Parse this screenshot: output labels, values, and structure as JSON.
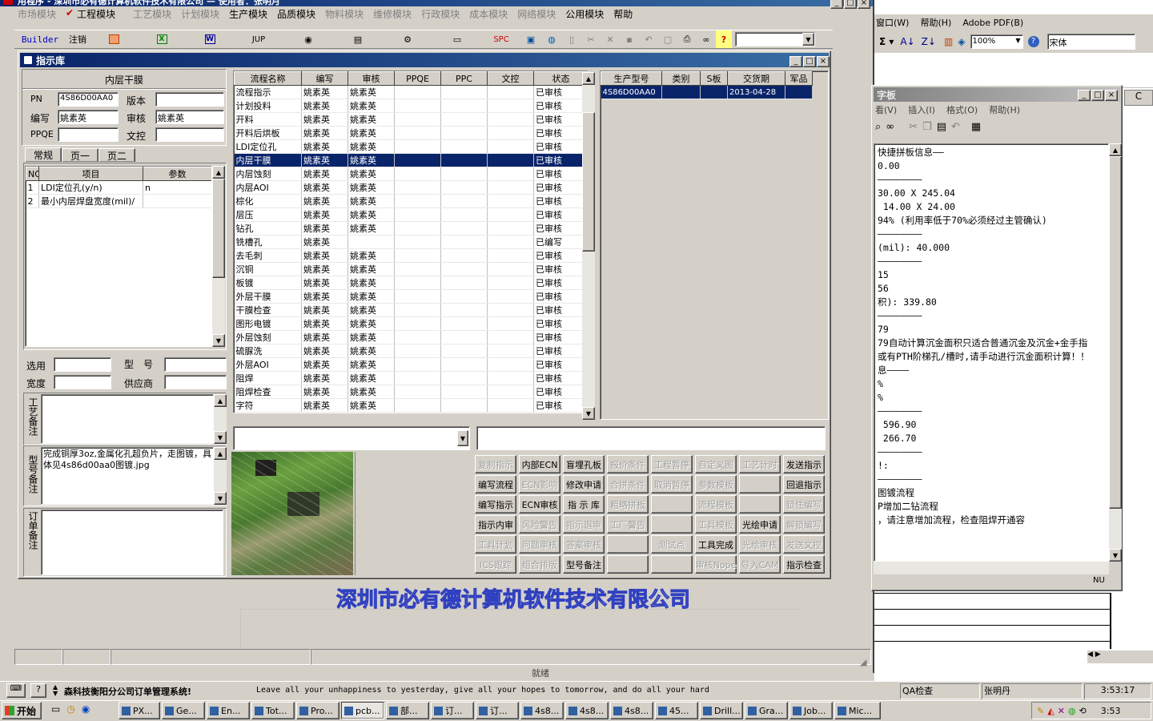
{
  "app": {
    "title": "用程序 - 深圳市必有德计算机软件技术有限公司 — 使用者：张明月",
    "menu": [
      "市场模块",
      "工程模块",
      "工艺模块",
      "计划模块",
      "生产模块",
      "品质模块",
      "物料模块",
      "维修模块",
      "行政模块",
      "成本模块",
      "网络模块",
      "公用模块",
      "帮助"
    ],
    "toolbar": {
      "builder": "Builder",
      "logout": "注销",
      "jup": "JUP",
      "spc": "SPC"
    },
    "company_watermark": "深圳市必有德计算机软件技术有限公司",
    "status_text": "就绪"
  },
  "dialog": {
    "title": "指示库",
    "left": {
      "header": "内层干膜",
      "pn_label": "PN",
      "pn_value": "4S86D00AA0",
      "version_label": "版本",
      "version_value": "",
      "writer_label": "编写",
      "writer_value": "姚素英",
      "reviewer_label": "审核",
      "reviewer_value": "姚素英",
      "ppqe_label": "PPQE",
      "ppqe_value": "",
      "doc_label": "文控",
      "doc_value": "",
      "tabs": [
        "常规",
        "页一",
        "页二"
      ],
      "param_cols": [
        "NO",
        "项目",
        "参数"
      ],
      "params": [
        {
          "no": "1",
          "item": "LDI定位孔(y/n)",
          "value": "n"
        },
        {
          "no": "2",
          "item": "最小内层焊盘宽度(mil)/",
          "value": ""
        }
      ],
      "select_label": "选用",
      "model_label": "型　号",
      "width_label": "宽度",
      "supplier_label": "供应商",
      "remark1_label": "工艺备注",
      "remark2_label": "型号备注",
      "remark2_text": "完成铜厚3oz,金属化孔超负片，走图镀，具体见4s86d00aa0图镀.jpg",
      "remark3_label": "订单备注"
    },
    "flow_cols": [
      "流程名称",
      "编写",
      "审核",
      "PPQE",
      "PPC",
      "文控",
      "状态"
    ],
    "flows": [
      {
        "name": "流程指示",
        "writer": "姚素英",
        "reviewer": "姚素英",
        "status": "已审核"
      },
      {
        "name": "计划投料",
        "writer": "姚素英",
        "reviewer": "姚素英",
        "status": "已审核"
      },
      {
        "name": "开料",
        "writer": "姚素英",
        "reviewer": "姚素英",
        "status": "已审核"
      },
      {
        "name": "开料后烘板",
        "writer": "姚素英",
        "reviewer": "姚素英",
        "status": "已审核"
      },
      {
        "name": "LDI定位孔",
        "writer": "姚素英",
        "reviewer": "姚素英",
        "status": "已审核"
      },
      {
        "name": "内层干膜",
        "writer": "姚素英",
        "reviewer": "姚素英",
        "status": "已审核"
      },
      {
        "name": "内层蚀刻",
        "writer": "姚素英",
        "reviewer": "姚素英",
        "status": "已审核"
      },
      {
        "name": "内层AOI",
        "writer": "姚素英",
        "reviewer": "姚素英",
        "status": "已审核"
      },
      {
        "name": "棕化",
        "writer": "姚素英",
        "reviewer": "姚素英",
        "status": "已审核"
      },
      {
        "name": "层压",
        "writer": "姚素英",
        "reviewer": "姚素英",
        "status": "已审核"
      },
      {
        "name": "钻孔",
        "writer": "姚素英",
        "reviewer": "姚素英",
        "status": "已审核"
      },
      {
        "name": "铣槽孔",
        "writer": "姚素英",
        "reviewer": "",
        "status": "已编写"
      },
      {
        "name": "去毛刺",
        "writer": "姚素英",
        "reviewer": "姚素英",
        "status": "已审核"
      },
      {
        "name": "沉铜",
        "writer": "姚素英",
        "reviewer": "姚素英",
        "status": "已审核"
      },
      {
        "name": "板镀",
        "writer": "姚素英",
        "reviewer": "姚素英",
        "status": "已审核"
      },
      {
        "name": "外层干膜",
        "writer": "姚素英",
        "reviewer": "姚素英",
        "status": "已审核"
      },
      {
        "name": "干膜检查",
        "writer": "姚素英",
        "reviewer": "姚素英",
        "status": "已审核"
      },
      {
        "name": "图形电镀",
        "writer": "姚素英",
        "reviewer": "姚素英",
        "status": "已审核"
      },
      {
        "name": "外层蚀刻",
        "writer": "姚素英",
        "reviewer": "姚素英",
        "status": "已审核"
      },
      {
        "name": "硫脲洗",
        "writer": "姚素英",
        "reviewer": "姚素英",
        "status": "已审核"
      },
      {
        "name": "外层AOI",
        "writer": "姚素英",
        "reviewer": "姚素英",
        "status": "已审核"
      },
      {
        "name": "阻焊",
        "writer": "姚素英",
        "reviewer": "姚素英",
        "status": "已审核"
      },
      {
        "name": "阻焊检查",
        "writer": "姚素英",
        "reviewer": "姚素英",
        "status": "已审核"
      },
      {
        "name": "字符",
        "writer": "姚素英",
        "reviewer": "姚素英",
        "status": "已审核"
      }
    ],
    "selected_flow_index": 5,
    "model_cols": [
      "生产型号",
      "类别",
      "S板",
      "交货期",
      "军品"
    ],
    "models": [
      {
        "model": "4S86D00AA0",
        "category": "",
        "s": "",
        "due": "2013-04-28",
        "mil": ""
      }
    ],
    "actions": [
      [
        {
          "t": "复制指示",
          "e": false
        },
        {
          "t": "内部ECN",
          "e": true
        },
        {
          "t": "盲埋孔板",
          "e": true
        },
        {
          "t": "报价条件",
          "e": false
        },
        {
          "t": "工程暂停",
          "e": false
        },
        {
          "t": "自定义图",
          "e": false
        },
        {
          "t": "工艺计时",
          "e": false
        },
        {
          "t": "发送指示",
          "e": true
        }
      ],
      [
        {
          "t": "编写流程",
          "e": true
        },
        {
          "t": "ECN影响",
          "e": false
        },
        {
          "t": "修改申请",
          "e": true
        },
        {
          "t": "合拼条件",
          "e": false
        },
        {
          "t": "取消暂停",
          "e": false
        },
        {
          "t": "参数模板",
          "e": false
        },
        {
          "t": "",
          "e": false
        },
        {
          "t": "回退指示",
          "e": true
        }
      ],
      [
        {
          "t": "编写指示",
          "e": true
        },
        {
          "t": "ECN审核",
          "e": true
        },
        {
          "t": "指 示 库",
          "e": true
        },
        {
          "t": "粗略拼板",
          "e": false
        },
        {
          "t": "",
          "e": false
        },
        {
          "t": "流程模板",
          "e": false
        },
        {
          "t": "",
          "e": false
        },
        {
          "t": "锁住编写",
          "e": false
        }
      ],
      [
        {
          "t": "指示内审",
          "e": true
        },
        {
          "t": "风险警告",
          "e": false
        },
        {
          "t": "指示退审",
          "e": false
        },
        {
          "t": "工厂警告",
          "e": false
        },
        {
          "t": "",
          "e": false
        },
        {
          "t": "工具模板",
          "e": false
        },
        {
          "t": "光绘申请",
          "e": true
        },
        {
          "t": "解锁编写",
          "e": false
        }
      ],
      [
        {
          "t": "工具计划",
          "e": false
        },
        {
          "t": "问题审核",
          "e": false
        },
        {
          "t": "答案审核",
          "e": false
        },
        {
          "t": "",
          "e": false
        },
        {
          "t": "测试点",
          "e": false
        },
        {
          "t": "工具完成",
          "e": true
        },
        {
          "t": "光绘审核",
          "e": false
        },
        {
          "t": "发送文控",
          "e": false
        }
      ],
      [
        {
          "t": "ICS跟踪",
          "e": false
        },
        {
          "t": "组合排版",
          "e": false
        },
        {
          "t": "型号备注",
          "e": true
        },
        {
          "t": "",
          "e": false
        },
        {
          "t": "",
          "e": false
        },
        {
          "t": "审核Nope",
          "e": false
        },
        {
          "t": "导入CAM",
          "e": false
        },
        {
          "t": "指示检查",
          "e": true
        }
      ]
    ]
  },
  "excel": {
    "menu": [
      "窗口(W)",
      "帮助(H)",
      "Adobe PDF(B)"
    ],
    "zoom": "100%",
    "font": "宋体",
    "col_header": "C"
  },
  "notepad": {
    "title": "字板",
    "menu": [
      "看(V)",
      "插入(I)",
      "格式(O)",
      "帮助(H)"
    ],
    "lines": [
      "快捷拼板信息——",
      "0.00",
      "",
      "————————",
      "30.00 X 245.04",
      " 14.00 X 24.00",
      "94% (利用率低于70%必须经过主管确认)",
      "————————",
      "(mil): 40.000",
      "————————",
      "",
      "15",
      "56",
      "积): 339.80",
      "",
      "————————",
      "79",
      "79自动计算沉金面积只适合普通沉金及沉金+金手指",
      "或有PTH阶梯孔/槽时,请手动进行沉金面积计算！！",
      "息————",
      "%",
      "%",
      "————————",
      " 596.90",
      " 266.70",
      "————————",
      "!:",
      "",
      "————————",
      "图镀流程",
      "P增加二钻流程",
      "，请注意增加流程，检查阻焊开通容"
    ],
    "status": "NU"
  },
  "bottom": {
    "ticker_left": "森科技衡阳分公司订单管理系统!",
    "ticker": "Leave all your unhappiness to yesterday, give all your hopes to tomorrow, and do all your hard",
    "qa": "QA检查",
    "user": "张明丹",
    "time": "3:53:17"
  },
  "taskbar": {
    "start": "开始",
    "items": [
      "PX...",
      "Ge...",
      "En...",
      "Tot...",
      "Pro...",
      "pcb...",
      "部...",
      "订...",
      "订...",
      "4s8...",
      "4s8...",
      "4s8...",
      "45...",
      "Drill...",
      "Gra...",
      "Job...",
      "Mic..."
    ],
    "clock": "3:53"
  }
}
